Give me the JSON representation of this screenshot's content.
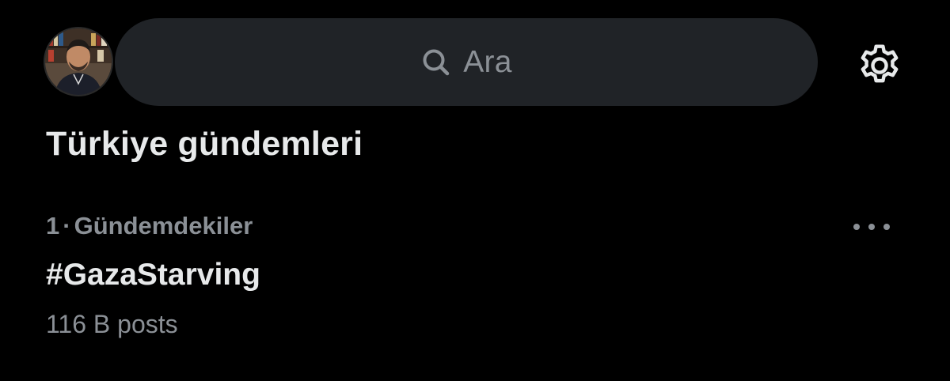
{
  "header": {
    "search_placeholder": "Ara",
    "icons": {
      "avatar": "profile-avatar",
      "search": "search-icon",
      "settings": "gear-icon"
    }
  },
  "section": {
    "title": "Türkiye gündemleri"
  },
  "trends": [
    {
      "rank": "1",
      "separator": "·",
      "category": "Gündemdekiler",
      "name": "#GazaStarving",
      "count": "116 B posts",
      "menu_icon": "more-horizontal-icon"
    }
  ],
  "colors": {
    "background": "#000000",
    "search_bg": "#202327",
    "primary_text": "#e7e9ea",
    "secondary_text": "#8b9096"
  }
}
